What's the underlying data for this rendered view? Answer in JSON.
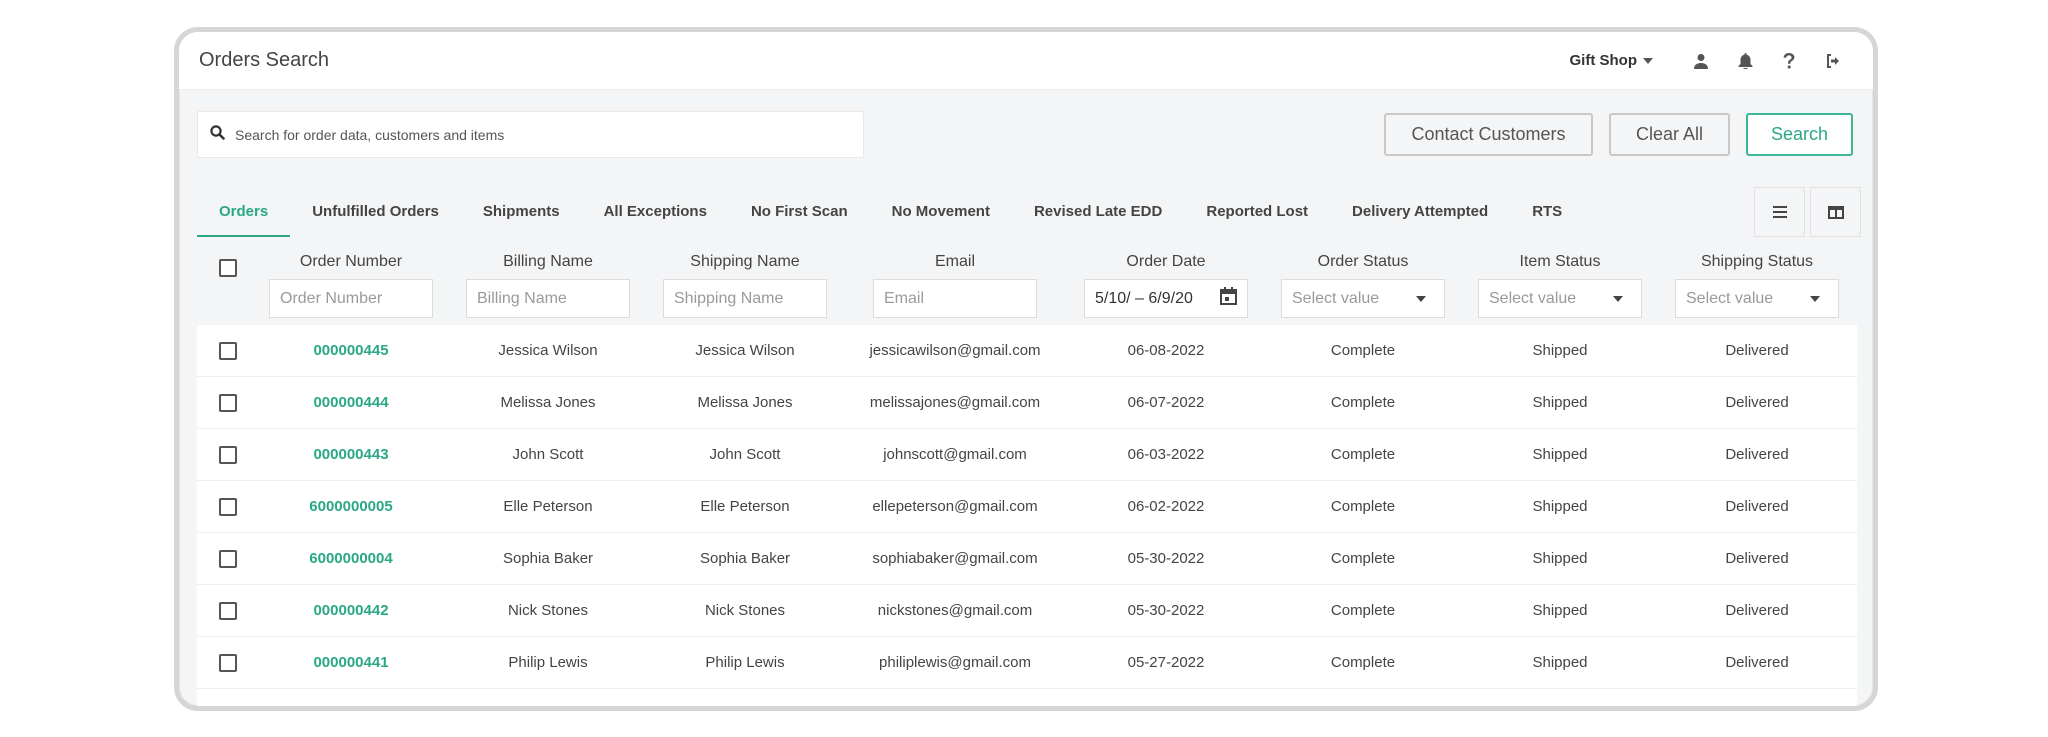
{
  "header": {
    "title": "Orders Search",
    "store": "Gift Shop",
    "icons": [
      "user-icon",
      "bell-icon",
      "help-icon",
      "logout-icon"
    ]
  },
  "search": {
    "placeholder": "Search for order data, customers and items",
    "value": ""
  },
  "actions": {
    "contact": "Contact Customers",
    "clear": "Clear All",
    "search": "Search"
  },
  "tabs": [
    {
      "label": "Orders",
      "active": true
    },
    {
      "label": "Unfulfilled Orders"
    },
    {
      "label": "Shipments"
    },
    {
      "label": "All Exceptions"
    },
    {
      "label": "No First Scan"
    },
    {
      "label": "No Movement"
    },
    {
      "label": "Revised Late EDD"
    },
    {
      "label": "Reported Lost"
    },
    {
      "label": "Delivery Attempted"
    },
    {
      "label": "RTS"
    }
  ],
  "columns": {
    "order_number": {
      "label": "Order Number",
      "placeholder": "Order Number"
    },
    "billing_name": {
      "label": "Billing Name",
      "placeholder": "Billing Name"
    },
    "shipping_name": {
      "label": "Shipping Name",
      "placeholder": "Shipping Name"
    },
    "email": {
      "label": "Email",
      "placeholder": "Email"
    },
    "order_date": {
      "label": "Order Date",
      "value": "5/10/ – 6/9/20"
    },
    "order_status": {
      "label": "Order Status",
      "value": "Select value"
    },
    "item_status": {
      "label": "Item Status",
      "value": "Select value"
    },
    "shipping_status": {
      "label": "Shipping Status",
      "value": "Select value"
    }
  },
  "rows": [
    {
      "order": "000000445",
      "billing": "Jessica Wilson",
      "shipping": "Jessica Wilson",
      "email": "jessicawilson@gmail.com",
      "date": "06-08-2022",
      "order_status": "Complete",
      "item_status": "Shipped",
      "shipping_status": "Delivered"
    },
    {
      "order": "000000444",
      "billing": "Melissa Jones",
      "shipping": "Melissa Jones",
      "email": "melissajones@gmail.com",
      "date": "06-07-2022",
      "order_status": "Complete",
      "item_status": "Shipped",
      "shipping_status": "Delivered"
    },
    {
      "order": "000000443",
      "billing": "John Scott",
      "shipping": "John Scott",
      "email": "johnscott@gmail.com",
      "date": "06-03-2022",
      "order_status": "Complete",
      "item_status": "Shipped",
      "shipping_status": "Delivered"
    },
    {
      "order": "6000000005",
      "billing": "Elle Peterson",
      "shipping": "Elle Peterson",
      "email": "ellepeterson@gmail.com",
      "date": "06-02-2022",
      "order_status": "Complete",
      "item_status": "Shipped",
      "shipping_status": "Delivered"
    },
    {
      "order": "6000000004",
      "billing": "Sophia Baker",
      "shipping": "Sophia Baker",
      "email": "sophiabaker@gmail.com",
      "date": "05-30-2022",
      "order_status": "Complete",
      "item_status": "Shipped",
      "shipping_status": "Delivered"
    },
    {
      "order": "000000442",
      "billing": "Nick Stones",
      "shipping": "Nick Stones",
      "email": "nickstones@gmail.com",
      "date": "05-30-2022",
      "order_status": "Complete",
      "item_status": "Shipped",
      "shipping_status": "Delivered"
    },
    {
      "order": "000000441",
      "billing": "Philip Lewis",
      "shipping": "Philip Lewis",
      "email": "philiplewis@gmail.com",
      "date": "05-27-2022",
      "order_status": "Complete",
      "item_status": "Shipped",
      "shipping_status": "Delivered"
    }
  ],
  "colors": {
    "accent": "#2aa886",
    "border": "#d6d6d6",
    "background": "#f4f5f6"
  }
}
